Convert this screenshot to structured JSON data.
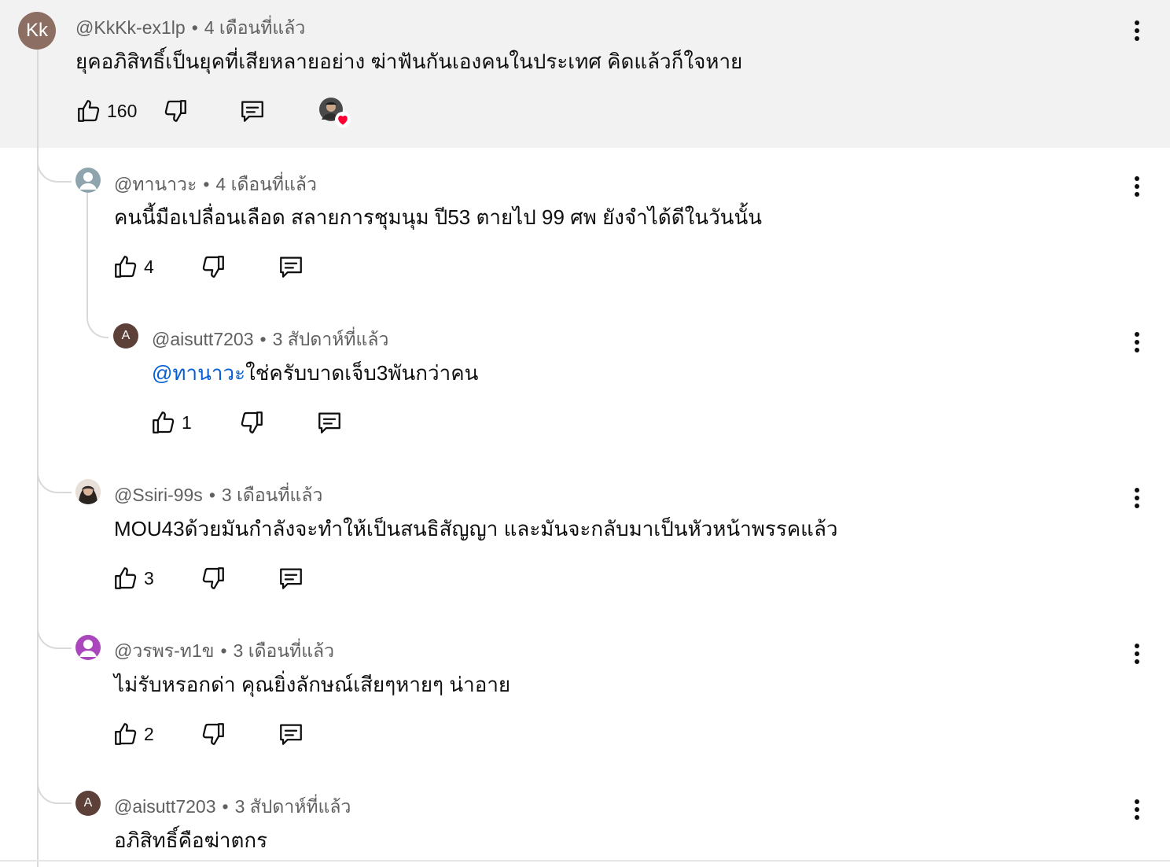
{
  "colors": {
    "highlight_bg": "#f2f2f2",
    "mention": "#065fd4",
    "meta_text": "#606060",
    "heart": "#ff0033"
  },
  "comments": [
    {
      "author": "@KkKk-ex1lp",
      "time": "4 เดือนที่แล้ว",
      "text": "ยุคอภิสิทธิ์เป็นยุคที่เสียหลายอย่าง ฆ่าฟันกันเองคนในประเทศ คิดแล้วก็ใจหาย",
      "likes": "160",
      "avatar_initials": "Kk",
      "avatar_color": "#8d6e63",
      "creator_heart": true
    },
    {
      "author": "@ทานาวะ",
      "time": "4 เดือนที่แล้ว",
      "text": "คนนี้มือเปลื่อนเลือด สลายการชุมนุม ปี53 ตายไป 99 ศพ ยังจำได้ดีในวันนั้น",
      "likes": "4",
      "avatar_icon": "person-icon",
      "avatar_color": "#90a4ae"
    },
    {
      "author": "@aisutt7203",
      "time": "3 สัปดาห์ที่แล้ว",
      "mention": "@ทานาวะ",
      "text": "ใช่ครับบาดเจ็บ3พันกว่าคน",
      "likes": "1",
      "avatar_initials": "A",
      "avatar_color": "#5d4037"
    },
    {
      "author": "@Ssiri-99s",
      "time": "3 เดือนที่แล้ว",
      "text": "MOU43ด้วยมันกำลังจะทำให้เป็นสนธิสัญญา และมันจะกลับมาเป็นหัวหน้าพรรคแล้ว",
      "likes": "3",
      "avatar_icon": "photo-avatar",
      "avatar_color": "#5a4a3a"
    },
    {
      "author": "@วรพร-ท1ข",
      "time": "3 เดือนที่แล้ว",
      "text": "ไม่รับหรอกด่า คุณยิ่งลักษณ์เสียๆหายๆ น่าอาย",
      "likes": "2",
      "avatar_icon": "person-icon",
      "avatar_color": "#ab47bc"
    },
    {
      "author": "@aisutt7203",
      "time": "3 สัปดาห์ที่แล้ว",
      "text": "อภิสิทธิ์คือฆ่าตกร",
      "avatar_initials": "A",
      "avatar_color": "#5d4037"
    }
  ]
}
